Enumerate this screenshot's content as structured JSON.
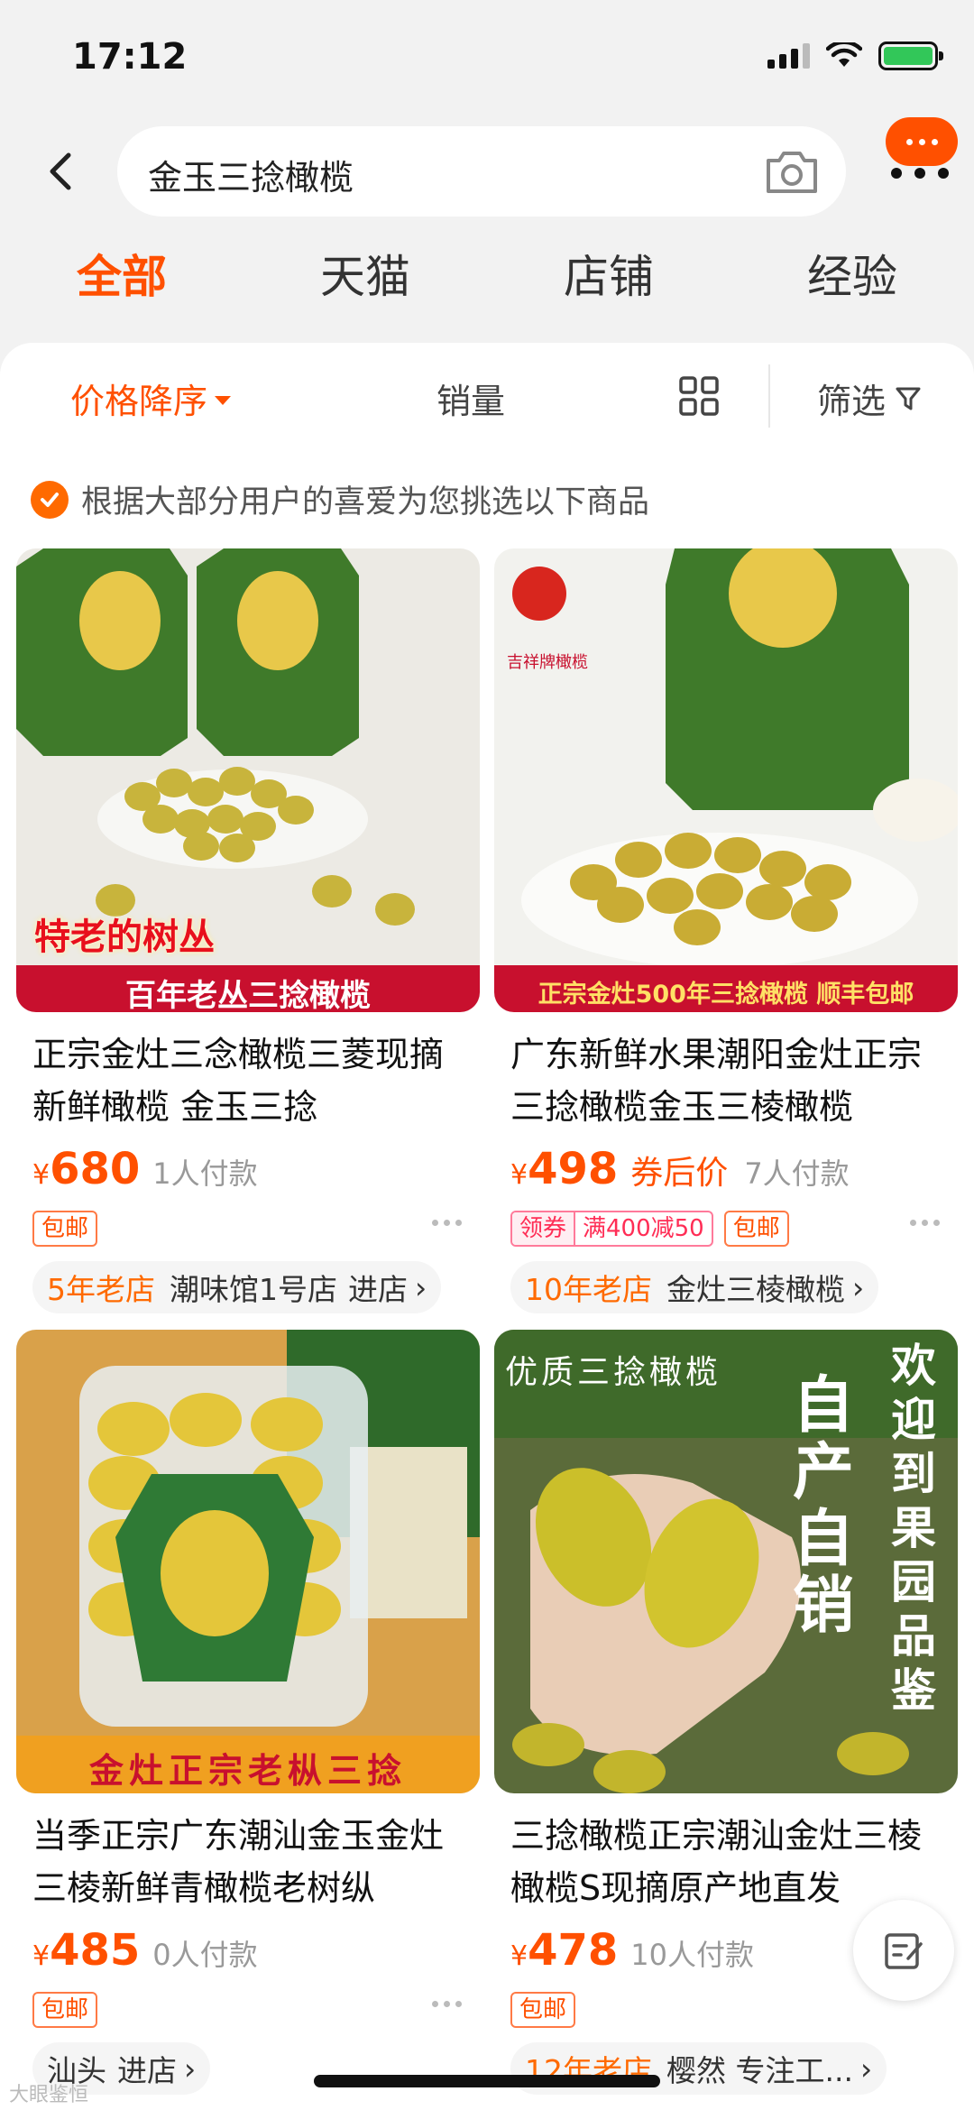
{
  "status_bar": {
    "time": "17:12"
  },
  "search": {
    "query": "金玉三捻橄榄"
  },
  "tabs": [
    {
      "label": "全部",
      "active": true
    },
    {
      "label": "天猫",
      "active": false
    },
    {
      "label": "店铺",
      "active": false
    },
    {
      "label": "经验",
      "active": false
    }
  ],
  "sort": {
    "price_desc": "价格降序",
    "sales": "销量",
    "filter": "筛选"
  },
  "notice": "根据大部分用户的喜爱为您挑选以下商品",
  "colors": {
    "accent": "#ff5000",
    "coupon": "#ff2d55"
  },
  "products": [
    {
      "image_caption_top": "特老的树丛",
      "image_caption_bottom": "百年老丛三捻橄榄",
      "title": "正宗金灶三念橄榄三菱现摘新鲜橄榄 金玉三捻",
      "currency": "¥",
      "price": "680",
      "coupon_price_label": "",
      "sold": "1人付款",
      "tags": [
        "包邮"
      ],
      "coupon": null,
      "shop_age": "5年老店",
      "shop_name": "潮味馆1号店",
      "shop_link": "进店"
    },
    {
      "image_caption_top": "吉祥牌橄榄",
      "image_caption_bottom": "正宗金灶500年三捻橄榄  顺丰包邮",
      "title": "广东新鲜水果潮阳金灶正宗三捻橄榄金玉三棱橄榄",
      "currency": "¥",
      "price": "498",
      "coupon_price_label": "券后价",
      "sold": "7人付款",
      "tags": [
        "包邮"
      ],
      "coupon": {
        "label": "领券",
        "value": "满400减50"
      },
      "shop_age": "10年老店",
      "shop_name": "金灶三棱橄榄",
      "shop_link": ""
    },
    {
      "image_caption_top": "",
      "image_caption_bottom": "金灶正宗老枞三捻",
      "title": "当季正宗广东潮汕金玉金灶三棱新鲜青橄榄老树纵",
      "currency": "¥",
      "price": "485",
      "coupon_price_label": "",
      "sold": "0人付款",
      "tags": [
        "包邮"
      ],
      "coupon": null,
      "shop_age": "",
      "shop_name": "汕头",
      "shop_link": "进店"
    },
    {
      "image_caption_top": "优质三捻橄榄",
      "image_caption_side": "自产自销",
      "image_caption_right": "欢迎到果园品鉴",
      "image_caption_bottom": "",
      "title": "三捻橄榄正宗潮汕金灶三棱橄榄S现摘原产地直发",
      "currency": "¥",
      "price": "478",
      "coupon_price_label": "",
      "sold": "10人付款",
      "tags": [
        "包邮"
      ],
      "coupon": null,
      "shop_age": "12年老店",
      "shop_name": "樱然 专注工...",
      "shop_link": ""
    }
  ],
  "watermark": "大眼鉴恒"
}
